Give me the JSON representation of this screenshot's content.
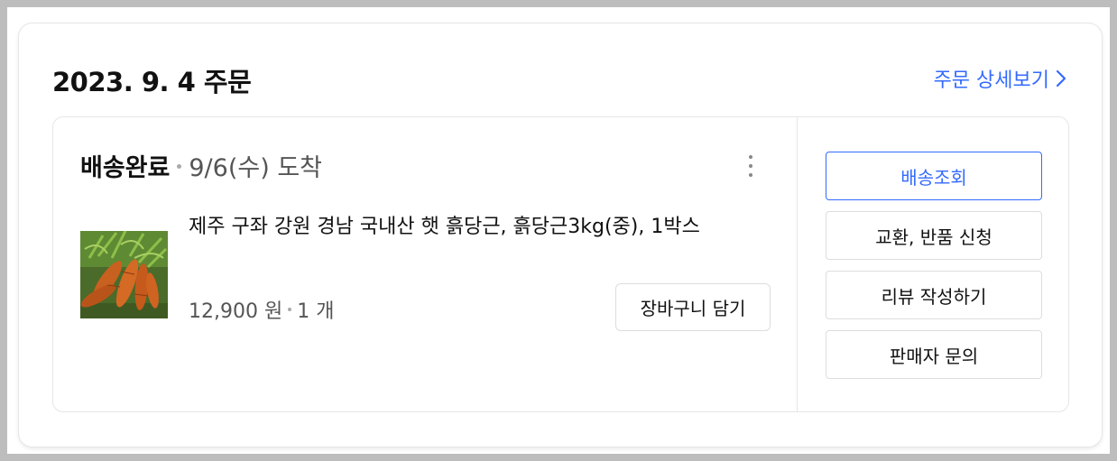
{
  "order": {
    "date_title": "2023. 9. 4 주문",
    "detail_link": "주문 상세보기"
  },
  "shipment": {
    "status": "배송완료",
    "arrival": "9/6(수) 도착"
  },
  "product": {
    "name": "제주 구좌 강원 경남 국내산 햇 흙당근, 흙당근3kg(중), 1박스",
    "price": "12,900 원",
    "quantity": "1 개",
    "image_icon": "carrots-photo",
    "add_to_cart_label": "장바구니 담기"
  },
  "actions": {
    "track": "배송조회",
    "exchange_return": "교환, 반품 신청",
    "write_review": "리뷰 작성하기",
    "ask_seller": "판매자 문의"
  },
  "colors": {
    "accent": "#346aff",
    "border": "#e6e6e6",
    "page_bg": "#bdbdbd"
  }
}
